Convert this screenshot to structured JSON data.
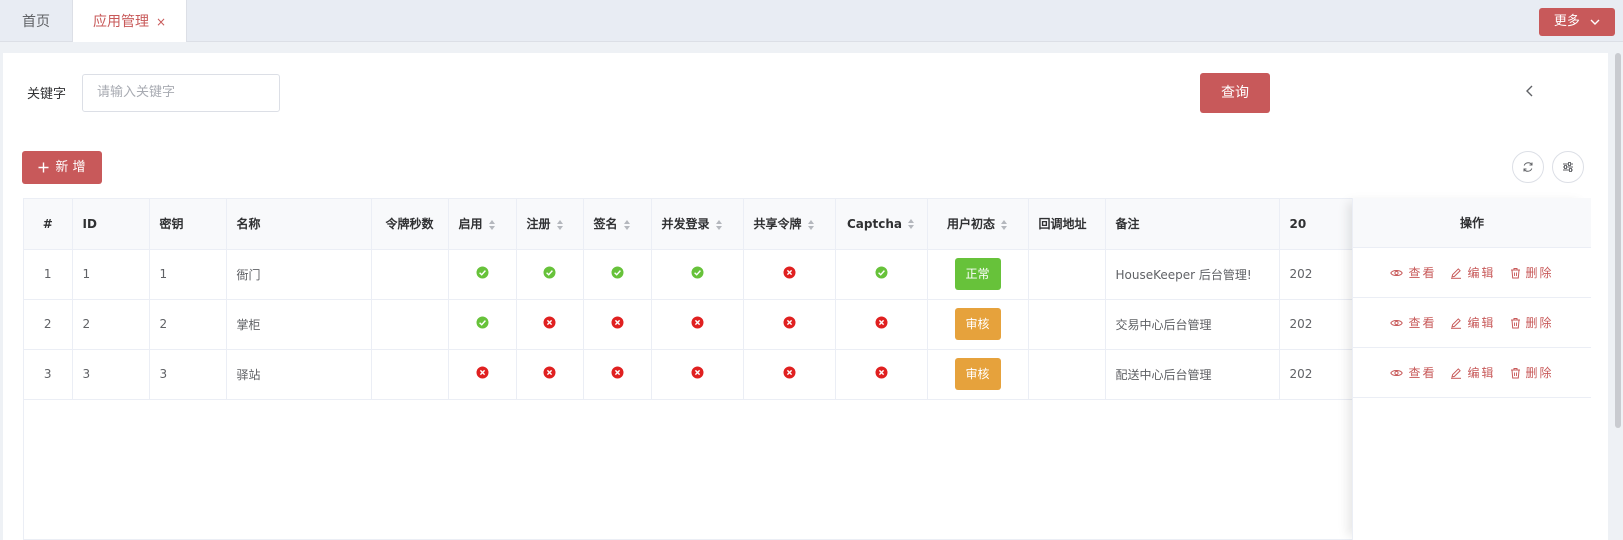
{
  "tabs": {
    "home": "首页",
    "app": "应用管理",
    "close": "×"
  },
  "more_button": "更多",
  "search": {
    "label": "关键字",
    "placeholder": "请输入关键字",
    "query_button": "查询"
  },
  "toolbar": {
    "add_button": "新 增"
  },
  "table": {
    "headers": [
      "#",
      "ID",
      "密钥",
      "名称",
      "令牌秒数",
      "启用",
      "注册",
      "签名",
      "并发登录",
      "共享令牌",
      "Captcha",
      "用户初态",
      "回调地址",
      "备注",
      "20"
    ],
    "rows": [
      {
        "index": "1",
        "id": "1",
        "key": "1",
        "name": "衙门",
        "token_seconds": "",
        "enabled": true,
        "register": true,
        "sign": true,
        "concurrent": true,
        "shared_token": false,
        "captcha": true,
        "user_state": "正常",
        "callback": "",
        "remark": "HouseKeeper 后台管理!",
        "created": "202"
      },
      {
        "index": "2",
        "id": "2",
        "key": "2",
        "name": "掌柜",
        "token_seconds": "",
        "enabled": true,
        "register": false,
        "sign": false,
        "concurrent": false,
        "shared_token": false,
        "captcha": false,
        "user_state": "审核",
        "callback": "",
        "remark": "交易中心后台管理",
        "created": "202"
      },
      {
        "index": "3",
        "id": "3",
        "key": "3",
        "name": "驿站",
        "token_seconds": "",
        "enabled": false,
        "register": false,
        "sign": false,
        "concurrent": false,
        "shared_token": false,
        "captcha": false,
        "user_state": "审核",
        "callback": "",
        "remark": "配送中心后台管理",
        "created": "202"
      }
    ]
  },
  "actions": {
    "header": "操作",
    "view": "查看",
    "edit": "编辑",
    "delete": "删除"
  },
  "colors": {
    "primary": "#c8595a",
    "success": "#67c23a",
    "warning": "#e6a23c",
    "danger": "#e02020"
  }
}
